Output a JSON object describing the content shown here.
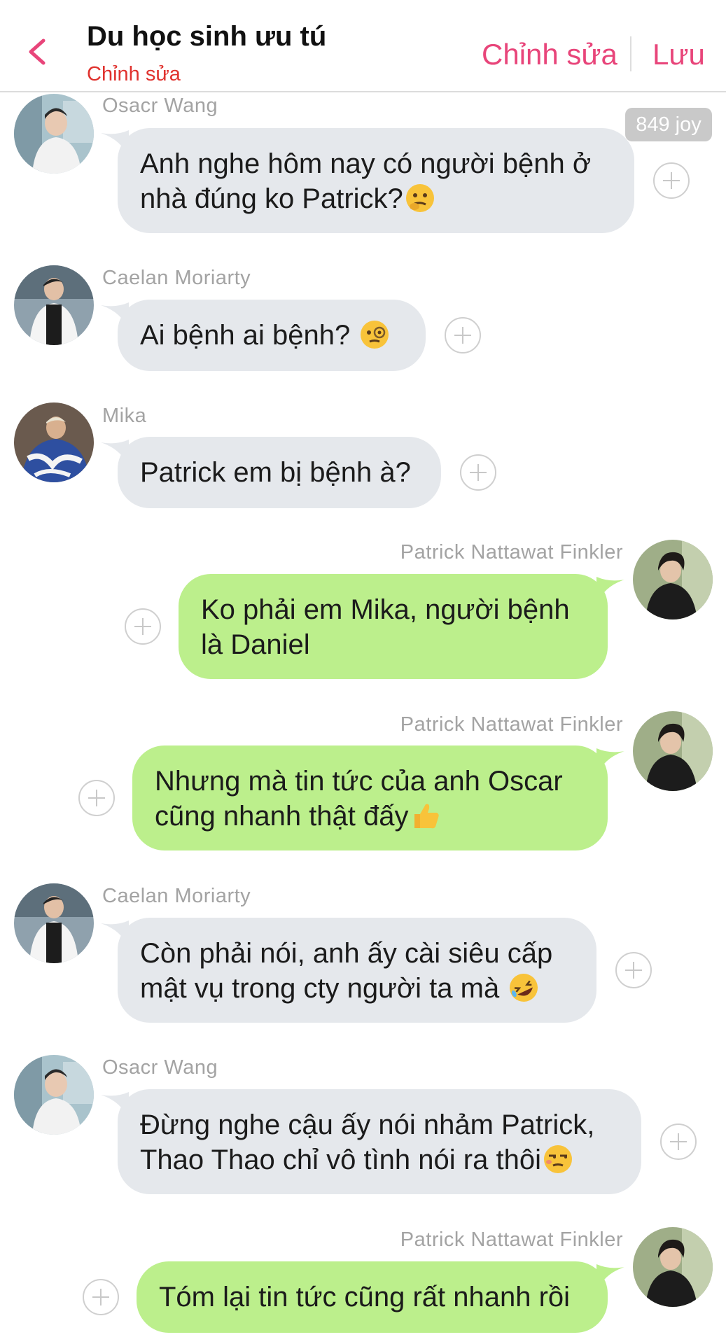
{
  "header": {
    "title": "Du học sinh ưu tú",
    "subtitle": "Chỉnh sửa",
    "edit_label": "Chỉnh sửa",
    "save_label": "Lưu",
    "accent_color": "#e8457a",
    "subtitle_color": "#e0322e"
  },
  "messages": [
    {
      "sender": "Osacr Wang",
      "side": "left",
      "lines": [
        "Anh nghe hôm nay có người bệnh ở",
        "nhà đúng ko Patrick?"
      ],
      "emoji": "thinking-face-emoji",
      "badge": "849 joy"
    },
    {
      "sender": "Caelan Moriarty",
      "side": "left",
      "lines": [
        "Ai bệnh ai bệnh? "
      ],
      "emoji": "monocle-face-emoji"
    },
    {
      "sender": "Mika",
      "side": "left",
      "lines": [
        "Patrick em bị bệnh à?"
      ]
    },
    {
      "sender": "Patrick Nattawat Finkler",
      "side": "right",
      "lines": [
        "Ko phải em Mika, người bệnh",
        "là Daniel"
      ]
    },
    {
      "sender": "Patrick Nattawat Finkler",
      "side": "right",
      "lines": [
        "Nhưng mà tin tức của anh Oscar",
        "cũng nhanh thật đấy"
      ],
      "emoji": "thumbs-up-emoji"
    },
    {
      "sender": "Caelan Moriarty",
      "side": "left",
      "lines": [
        "Còn phải nói, anh ấy cài siêu cấp",
        "mật vụ trong cty người ta mà "
      ],
      "emoji": "rolling-laughing-emoji"
    },
    {
      "sender": "Osacr Wang",
      "side": "left",
      "lines": [
        "Đừng nghe cậu ấy nói nhảm Patrick,",
        "Thao Thao chỉ vô tình nói ra thôi"
      ],
      "emoji": "unamused-face-emoji"
    },
    {
      "sender": "Patrick Nattawat Finkler",
      "side": "right",
      "lines": [
        "Tóm lại tin tức cũng rất nhanh rồi"
      ]
    }
  ],
  "colors": {
    "incoming_bubble": "#e5e8ec",
    "outgoing_bubble": "#bcef8c",
    "sender_name": "#a3a3a3"
  }
}
